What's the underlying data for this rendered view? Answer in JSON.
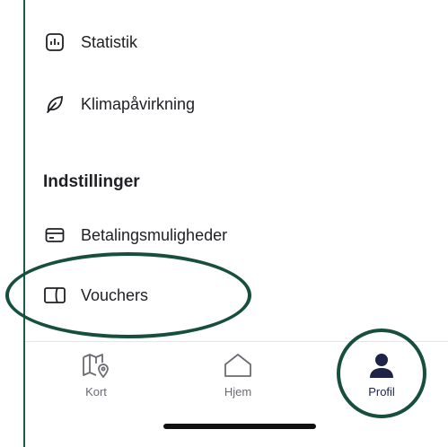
{
  "menu": {
    "items": [
      {
        "label": "Statistik",
        "icon": "bar-chart-icon"
      },
      {
        "label": "Klimapåvirkning",
        "icon": "leaf-icon"
      }
    ]
  },
  "settings": {
    "title": "Indstillinger",
    "items": [
      {
        "label": "Betalingsmuligheder",
        "icon": "credit-card-icon"
      },
      {
        "label": "Vouchers",
        "icon": "voucher-icon"
      }
    ]
  },
  "tabbar": {
    "tabs": [
      {
        "label": "Kort",
        "icon": "map-pin-icon"
      },
      {
        "label": "Hjem",
        "icon": "home-icon"
      },
      {
        "label": "Profil",
        "icon": "person-icon",
        "active": true
      }
    ]
  },
  "colors": {
    "highlight_ring": "#164f3d",
    "active_tab": "#1f2347",
    "inactive_tab": "#6b6b74"
  }
}
